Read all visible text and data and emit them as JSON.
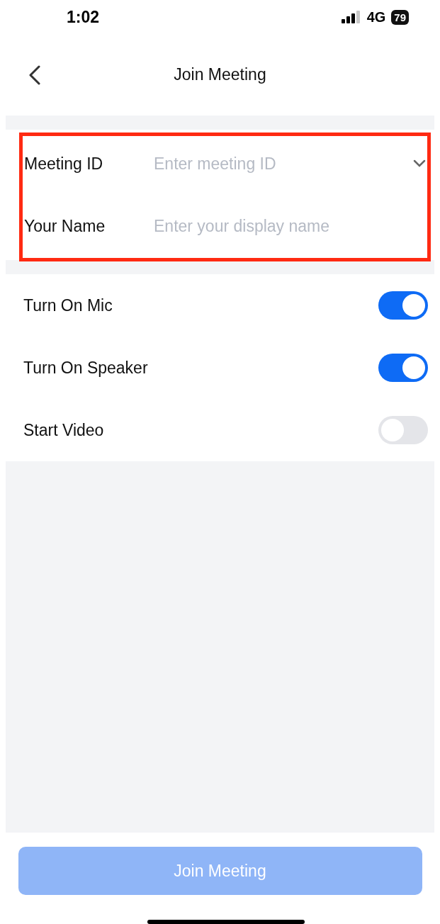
{
  "status_bar": {
    "time": "1:02",
    "network": "4G",
    "battery": "79"
  },
  "header": {
    "title": "Join Meeting"
  },
  "form": {
    "highlighted": true,
    "fields": [
      {
        "label": "Meeting ID",
        "placeholder": "Enter meeting ID",
        "has_dropdown": true
      },
      {
        "label": "Your Name",
        "placeholder": "Enter your display name",
        "has_dropdown": false
      }
    ]
  },
  "options": [
    {
      "label": "Turn On Mic",
      "on": true
    },
    {
      "label": "Turn On Speaker",
      "on": true
    },
    {
      "label": "Start Video",
      "on": false
    }
  ],
  "join_button": {
    "label": "Join Meeting",
    "disabled": true
  }
}
